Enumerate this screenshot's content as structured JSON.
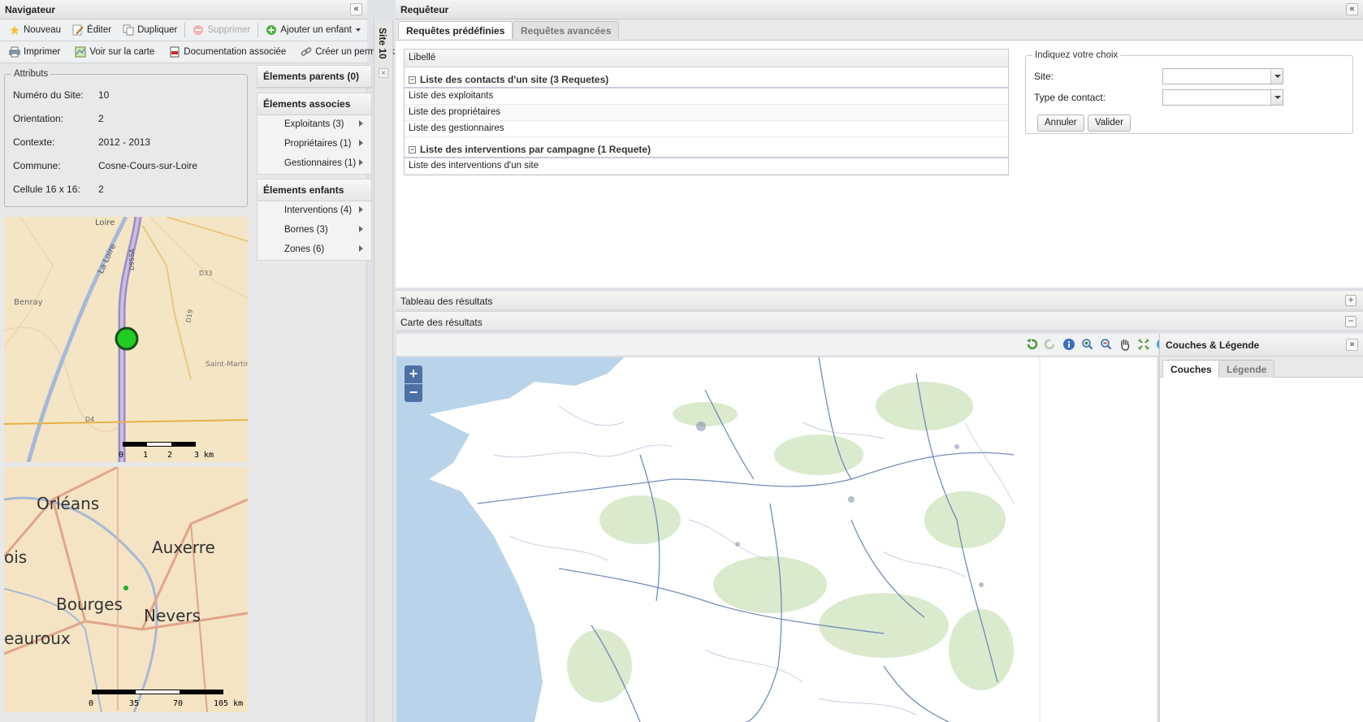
{
  "navigator": {
    "title": "Navigateur",
    "collapse_label": "«",
    "toolbar1": {
      "new": "Nouveau",
      "edit": "Éditer",
      "duplicate": "Dupliquer",
      "delete": "Supprimer",
      "add_child": "Ajouter un enfant"
    },
    "toolbar2": {
      "print": "Imprimer",
      "view_map": "Voir sur la carte",
      "documentation": "Documentation associée",
      "permalink": "Créer un permalink"
    },
    "vertical_tab": "Site 10",
    "attributes": {
      "legend": "Attributs",
      "rows": [
        {
          "label": "Numéro du Site:",
          "value": "10"
        },
        {
          "label": "Orientation:",
          "value": "2"
        },
        {
          "label": "Contexte:",
          "value": "2012 - 2013"
        },
        {
          "label": "Commune:",
          "value": "Cosne-Cours-sur-Loire"
        },
        {
          "label": "Cellule 16 x 16:",
          "value": "2"
        }
      ]
    },
    "minimap1": {
      "scale_labels": [
        "0",
        "1",
        "2",
        "3 km"
      ],
      "place_labels": [
        "Loire",
        "La Loire",
        "Benray",
        "Saint-Martin-sur-Nohain",
        "D33",
        "D4",
        "D955A",
        "D19"
      ]
    },
    "minimap2": {
      "scale_labels": [
        "0",
        "35",
        "70",
        "105 km"
      ],
      "cities": [
        "Orléans",
        "Auxerre",
        "ois",
        "Bourges",
        "Nevers",
        "eauroux"
      ]
    },
    "elements": {
      "parents_title": "Élements parents (0)",
      "associated_title": "Élements associes",
      "associated": [
        "Exploitants (3)",
        "Propriétaires (1)",
        "Gestionnaires (1)"
      ],
      "children_title": "Élements enfants",
      "children": [
        "Interventions (4)",
        "Bornes (3)",
        "Zones (6)"
      ]
    }
  },
  "requeteur": {
    "title": "Requêteur",
    "collapse_label": "«",
    "tabs": [
      {
        "label": "Requêtes prédéfinies",
        "active": true
      },
      {
        "label": "Requêtes avancées",
        "active": false
      }
    ],
    "grid": {
      "header": "Libellé",
      "groups": [
        {
          "title": "Liste des contacts d'un site (3 Requetes)",
          "rows": [
            "Liste des exploitants",
            "Liste des propriétaires",
            "Liste des gestionnaires"
          ]
        },
        {
          "title": "Liste des interventions par campagne (1 Requete)",
          "rows": [
            "Liste des interventions d'un site"
          ]
        }
      ]
    },
    "form": {
      "legend": "Indiquez votre choix",
      "site_label": "Site:",
      "contact_type_label": "Type de contact:",
      "site_value": "",
      "contact_type_value": "",
      "cancel": "Annuler",
      "submit": "Valider"
    },
    "results_table_title": "Tableau des résultats",
    "results_map_title": "Carte des résultats",
    "map": {
      "zoom_in": "+",
      "zoom_out": "−"
    },
    "layers": {
      "title": "Couches & Légende",
      "collapse_label": "»",
      "tabs": [
        {
          "label": "Couches",
          "active": true
        },
        {
          "label": "Légende",
          "active": false
        }
      ]
    }
  },
  "colors": {
    "site_marker": "#22cc22",
    "accent": "#1a5fb4"
  }
}
